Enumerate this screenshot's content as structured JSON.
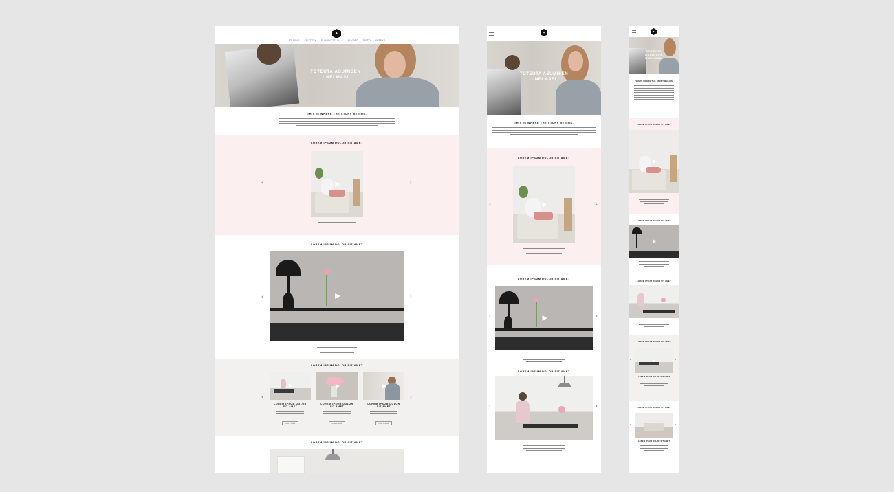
{
  "nav": {
    "items": [
      "ETUSIVU",
      "ESITTELY",
      "SUUNNITTELULLE",
      "ELVORO",
      "TIETO",
      "YHTEYS"
    ]
  },
  "hero": {
    "title_line1": "TOTEUTA ASUMISEN",
    "title_line2": "UNELMASI"
  },
  "intro": {
    "heading": "THIS IS WHERE THE STORY BEGINS."
  },
  "sections": {
    "s1_title": "LOREM IPSUM DOLOR SIT AMET",
    "s2_title": "LOREM IPSUM DOLOR SIT AMET",
    "s3_title": "LOREM IPSUM DOLOR SIT AMET",
    "s4_title": "LOREM IPSUM DOLOR SIT AMET",
    "card1_title_l1": "LOREM IPSUM DOLOR",
    "card1_title_l2": "SIT AMET",
    "card2_title_l1": "LOREM IPSUM DOLOR",
    "card2_title_l2": "SIT AMET",
    "card3_title_l1": "LOREM IPSUM DOLOR",
    "card3_title_l2": "SIT AMET",
    "card_button": "LUE LISÄÄ"
  },
  "mobile": {
    "title_line1": "TOTEUTA",
    "title_line2": "ASUMISEN",
    "title_line3": "UNELMASI",
    "intro_heading": "THIS IS WHERE THE STORY BEGINS.",
    "sec_title": "LOREM IPSUM DOLOR SIT AMET"
  },
  "colors": {
    "pink_band": "#fcefef",
    "grey_band": "#f2f1ef",
    "background": "#e6e6e6"
  },
  "icons": [
    "hexagon-logo-icon",
    "hamburger-menu-icon",
    "play-icon",
    "chevron-left-icon",
    "chevron-right-icon"
  ]
}
